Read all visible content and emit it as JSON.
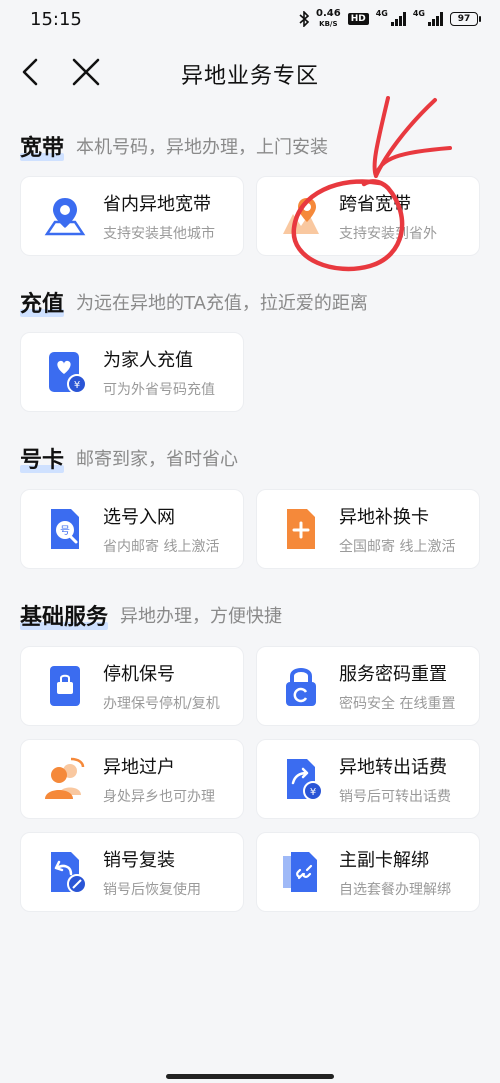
{
  "status_bar": {
    "time": "15:15",
    "speed_value": "0.46",
    "speed_unit": "KB/S",
    "hd": "HD",
    "net1": "4G",
    "net2": "4G",
    "battery": "97"
  },
  "nav": {
    "title": "异地业务专区"
  },
  "sections": {
    "broadband": {
      "title": "宽带",
      "subtitle": "本机号码，异地办理，上门安装",
      "items": [
        {
          "title": "省内异地宽带",
          "desc": "支持安装其他城市"
        },
        {
          "title": "跨省宽带",
          "desc": "支持安装到省外"
        }
      ]
    },
    "recharge": {
      "title": "充值",
      "subtitle": "为远在异地的TA充值，拉近爱的距离",
      "items": [
        {
          "title": "为家人充值",
          "desc": "可为外省号码充值"
        }
      ]
    },
    "simcard": {
      "title": "号卡",
      "subtitle": "邮寄到家，省时省心",
      "items": [
        {
          "title": "选号入网",
          "desc": "省内邮寄 线上激活"
        },
        {
          "title": "异地补换卡",
          "desc": "全国邮寄 线上激活"
        }
      ]
    },
    "basic": {
      "title": "基础服务",
      "subtitle": "异地办理，方便快捷",
      "items": [
        {
          "title": "停机保号",
          "desc": "办理保号停机/复机"
        },
        {
          "title": "服务密码重置",
          "desc": "密码安全 在线重置"
        },
        {
          "title": "异地过户",
          "desc": "身处异乡也可办理"
        },
        {
          "title": "异地转出话费",
          "desc": "销号后可转出话费"
        },
        {
          "title": "销号复装",
          "desc": "销号后恢复使用"
        },
        {
          "title": "主副卡解绑",
          "desc": "自选套餐办理解绑"
        }
      ]
    }
  },
  "colors": {
    "accent_blue": "#3b6cf0",
    "accent_orange": "#f5893a",
    "annotation_red": "#e8393f",
    "highlight": "#cfe1ff"
  }
}
